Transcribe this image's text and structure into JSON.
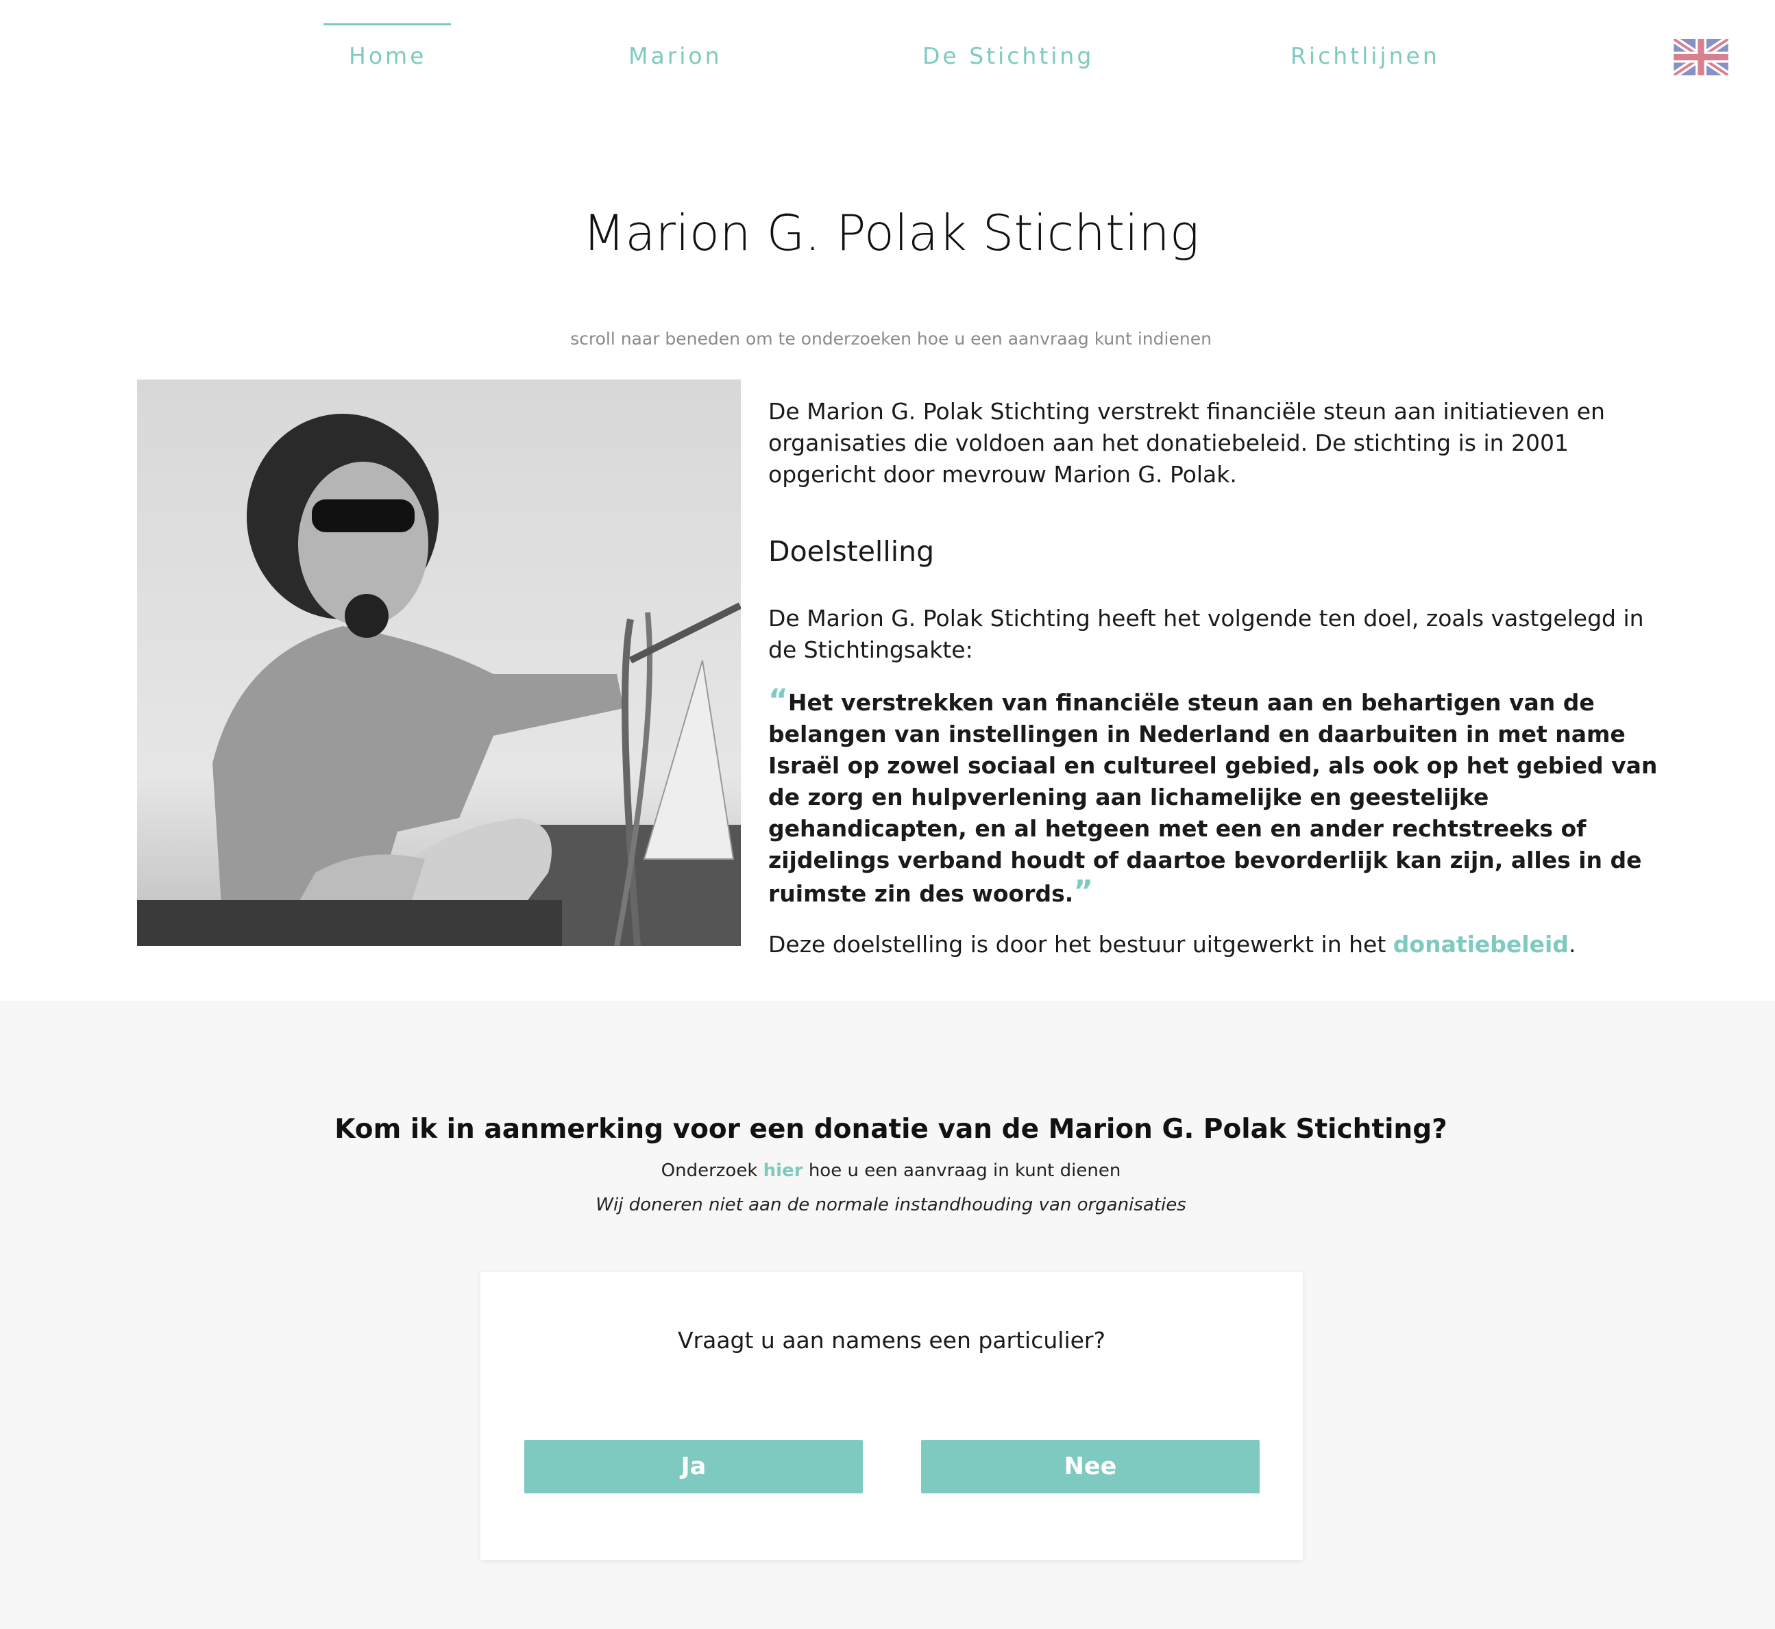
{
  "nav": {
    "items": [
      {
        "label": "Home"
      },
      {
        "label": "Marion"
      },
      {
        "label": "De Stichting"
      },
      {
        "label": "Richtlijnen"
      }
    ],
    "active_index": 0,
    "language_icon": "uk-flag-icon"
  },
  "hero": {
    "title": "Marion G. Polak Stichting",
    "scroll_hint": "scroll naar beneden om te onderzoeken hoe u een aanvraag kunt indienen"
  },
  "about": {
    "intro": "De Marion G. Polak Stichting verstrekt financiële steun aan initiatieven en organisaties die voldoen aan het donatiebeleid. De stichting is in 2001 opgericht door mevrouw Marion G. Polak.",
    "heading": "Doelstelling",
    "paragraph": "De Marion G. Polak Stichting heeft het volgende ten doel, zoals vastgelegd in de Stichtingsakte:",
    "quote_open": "“",
    "quote": "Het verstrekken van financiële steun aan en behartigen van de belangen van instellingen in Nederland en daarbuiten in met name Israël op zowel sociaal en cultureel gebied, als ook op het gebied van de zorg en hulpverlening aan lichamelijke en geestelijke gehandicapten, en al hetgeen met een en ander rechtstreeks of zijdelings verband houdt of daartoe bevorderlijk kan zijn, alles in de ruimste zin des woords.",
    "quote_close": "”",
    "closing_prefix": "Deze doelstelling is door het bestuur uitgewerkt in het ",
    "closing_link": "donatiebeleid",
    "closing_suffix": "."
  },
  "cta": {
    "heading": "Kom ik in aanmerking voor een donatie van de Marion G. Polak Stichting?",
    "sub_prefix": "Onderzoek ",
    "sub_link": "hier",
    "sub_suffix": " hoe u een aanvraag in kunt dienen",
    "note": "Wij doneren niet aan de normale instandhouding van organisaties",
    "card": {
      "question": "Vraagt u aan namens een particulier?",
      "yes_label": "Ja",
      "no_label": "Nee"
    }
  },
  "colors": {
    "accent": "#7ecac0",
    "section_bg": "#f7f7f7",
    "text": "#1a1a1a",
    "muted": "#8a8a8a"
  }
}
